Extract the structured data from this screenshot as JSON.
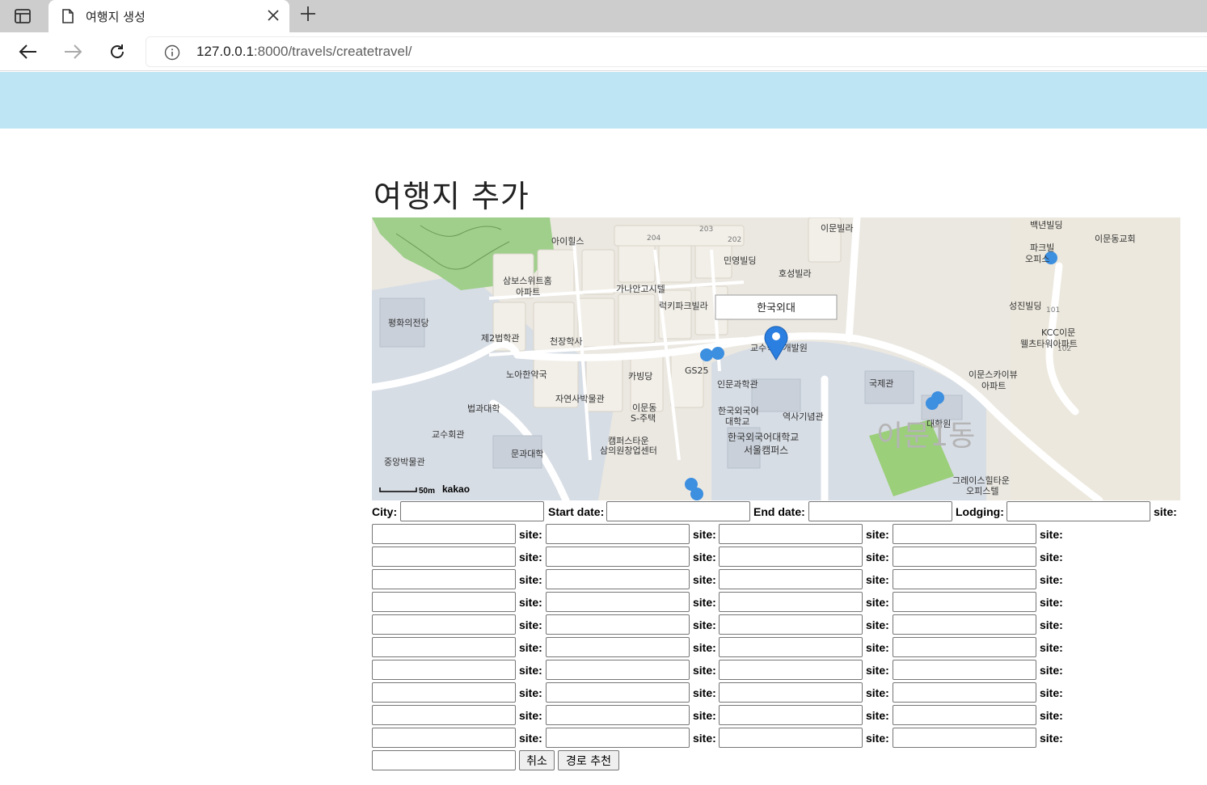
{
  "browser": {
    "tab_title": "여행지 생성",
    "url_host": "127.0.0.1",
    "url_rest": ":8000/travels/createtravel/",
    "icons": [
      "sidebar-icon",
      "page-icon",
      "close-icon",
      "plus-icon",
      "back-icon",
      "forward-icon",
      "reload-icon",
      "info-icon"
    ]
  },
  "page": {
    "header_color": "#bde5f4",
    "title": "여행지 추가"
  },
  "map": {
    "marker_label": "한국외대",
    "scale_label": "50m",
    "provider": "kakao",
    "labels": [
      "아이힐스",
      "이문빌라",
      "백년빌딩",
      "이문동교회",
      "삼보스위트홈",
      "아파트",
      "가나안고시텔",
      "민영빌딩",
      "호성빌라",
      "파크빌",
      "오피스",
      "평화의전당",
      "제2법학관",
      "천장학사",
      "럭키파크빌라",
      "성진빌딩",
      "KCC이문",
      "웰츠타워아파트",
      "교수학습개발원",
      "노아한약국",
      "카빙당",
      "GS25",
      "인문과학관",
      "국제관",
      "이문스카이뷰",
      "법과대학",
      "자연사박물관",
      "이문동",
      "S-주택",
      "한국외국어",
      "대학교",
      "역사기념관",
      "대학원",
      "교수회관",
      "한국외국어대학교",
      "서울캠퍼스",
      "이문1동",
      "캠퍼스타운",
      "삼의원창업센터",
      "문과대학",
      "중앙박물관",
      "그레이스힐타운",
      "오피스텔",
      "204",
      "203",
      "202",
      "101",
      "102"
    ]
  },
  "form": {
    "city_label": "City:",
    "start_label": "Start date:",
    "end_label": "End date:",
    "lodging_label": "Lodging:",
    "site_label": "site:",
    "cancel_label": "취소",
    "route_label": "경로 추천"
  }
}
